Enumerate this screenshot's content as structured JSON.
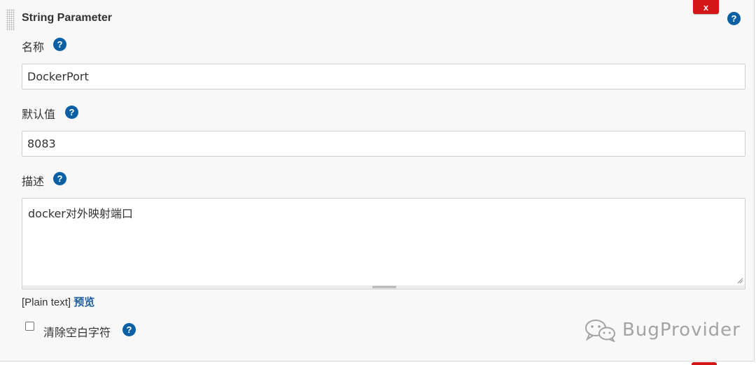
{
  "section": {
    "title": "String Parameter",
    "delete_label": "x",
    "help_label": "?"
  },
  "name_field": {
    "label": "名称",
    "value": "DockerPort"
  },
  "default_field": {
    "label": "默认值",
    "value": "8083"
  },
  "description_field": {
    "label": "描述",
    "value": "docker对外映射端口",
    "markup_format": "[Plain text]",
    "preview_label": "预览"
  },
  "trim_option": {
    "label": "清除空白字符",
    "checked": false
  },
  "watermark": {
    "text": "BugProvider",
    "icon": "wechat-icon"
  },
  "colors": {
    "delete_red": "#d41616",
    "help_blue": "#0b5fa4",
    "link_blue": "#1e5d9c"
  }
}
